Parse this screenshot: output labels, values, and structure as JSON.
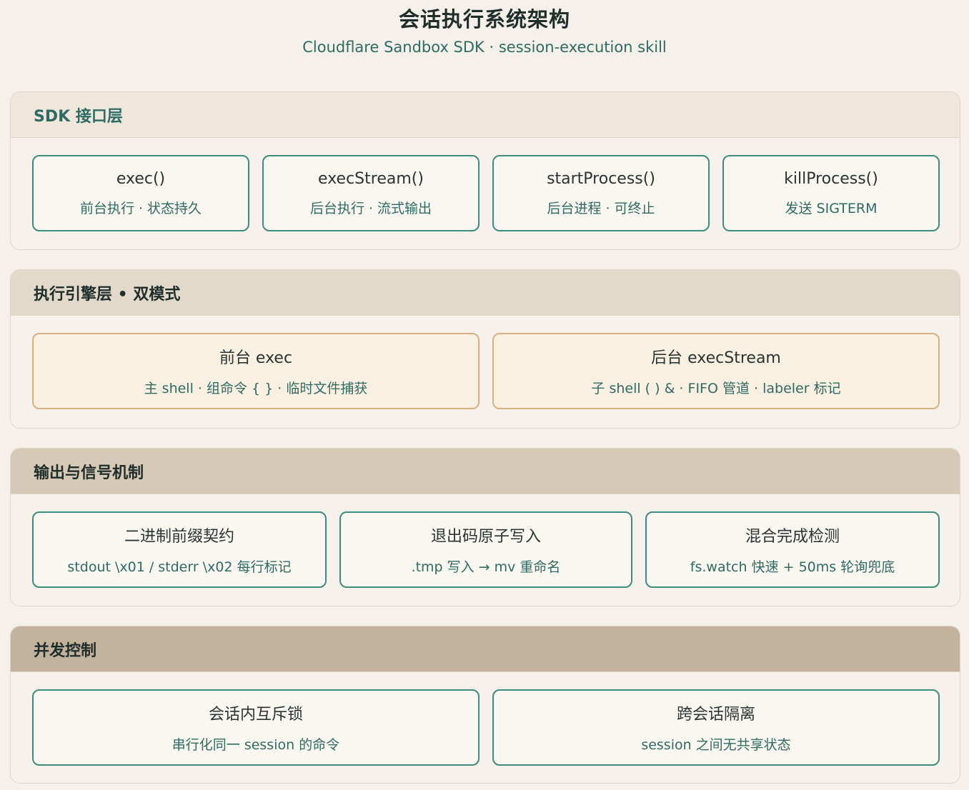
{
  "header": {
    "title": "会话执行系统架构",
    "subtitle": "Cloudflare Sandbox SDK · session-execution skill"
  },
  "layers": [
    {
      "title": "SDK 接口层",
      "boxes": [
        {
          "title": "exec()",
          "desc": "前台执行 · 状态持久"
        },
        {
          "title": "execStream()",
          "desc": "后台执行 · 流式输出"
        },
        {
          "title": "startProcess()",
          "desc": "后台进程 · 可终止"
        },
        {
          "title": "killProcess()",
          "desc": "发送 SIGTERM"
        }
      ]
    },
    {
      "title": "执行引擎层 • 双模式",
      "boxes": [
        {
          "title": "前台 exec",
          "desc": "主 shell · 组命令 { } · 临时文件捕获"
        },
        {
          "title": "后台 execStream",
          "desc": "子 shell ( ) & · FIFO 管道 · labeler 标记"
        }
      ]
    },
    {
      "title": "输出与信号机制",
      "boxes": [
        {
          "title": "二进制前缀契约",
          "desc": "stdout \\x01 / stderr \\x02 每行标记"
        },
        {
          "title": "退出码原子写入",
          "desc": ".tmp 写入 → mv 重命名"
        },
        {
          "title": "混合完成检测",
          "desc": "fs.watch 快速 + 50ms 轮询兜底"
        }
      ]
    },
    {
      "title": "并发控制",
      "boxes": [
        {
          "title": "会话内互斥锁",
          "desc": "串行化同一 session 的命令"
        },
        {
          "title": "跨会话隔离",
          "desc": "session 之间无共享状态"
        }
      ]
    }
  ]
}
